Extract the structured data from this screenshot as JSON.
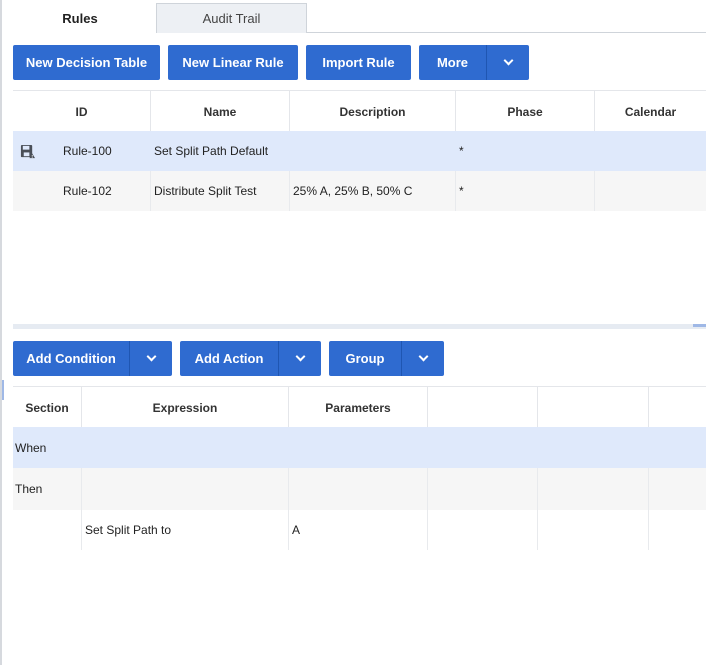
{
  "tabs": [
    {
      "label": "Rules",
      "active": true
    },
    {
      "label": "Audit Trail",
      "active": false
    }
  ],
  "toolbar": {
    "new_decision_table": "New Decision Table",
    "new_linear_rule": "New Linear Rule",
    "import_rule": "Import Rule",
    "more": "More"
  },
  "rules_table": {
    "columns": [
      "ID",
      "Name",
      "Description",
      "Phase",
      "Calendar"
    ],
    "rows": [
      {
        "id": "Rule-100",
        "name": "Set Split Path Default",
        "description": "",
        "phase": "*",
        "calendar": "",
        "selected": true,
        "icon": "save-icon"
      },
      {
        "id": "Rule-102",
        "name": "Distribute Split Test",
        "description": "25% A, 25% B, 50% C",
        "phase": "*",
        "calendar": "",
        "selected": false
      }
    ]
  },
  "editor_toolbar": {
    "add_condition": "Add Condition",
    "add_action": "Add Action",
    "group": "Group"
  },
  "rule_editor": {
    "columns": [
      "Section",
      "Expression",
      "Parameters",
      "",
      "",
      ""
    ],
    "rows": [
      {
        "section": "When",
        "expression": "",
        "parameters": ""
      },
      {
        "section": "Then",
        "expression": "",
        "parameters": ""
      },
      {
        "section": "",
        "expression": "Set Split Path to",
        "parameters": "A"
      }
    ]
  },
  "colors": {
    "primary_button": "#2f6bd0",
    "selected_row": "#dfe9fb",
    "alt_row": "#f6f6f6"
  }
}
